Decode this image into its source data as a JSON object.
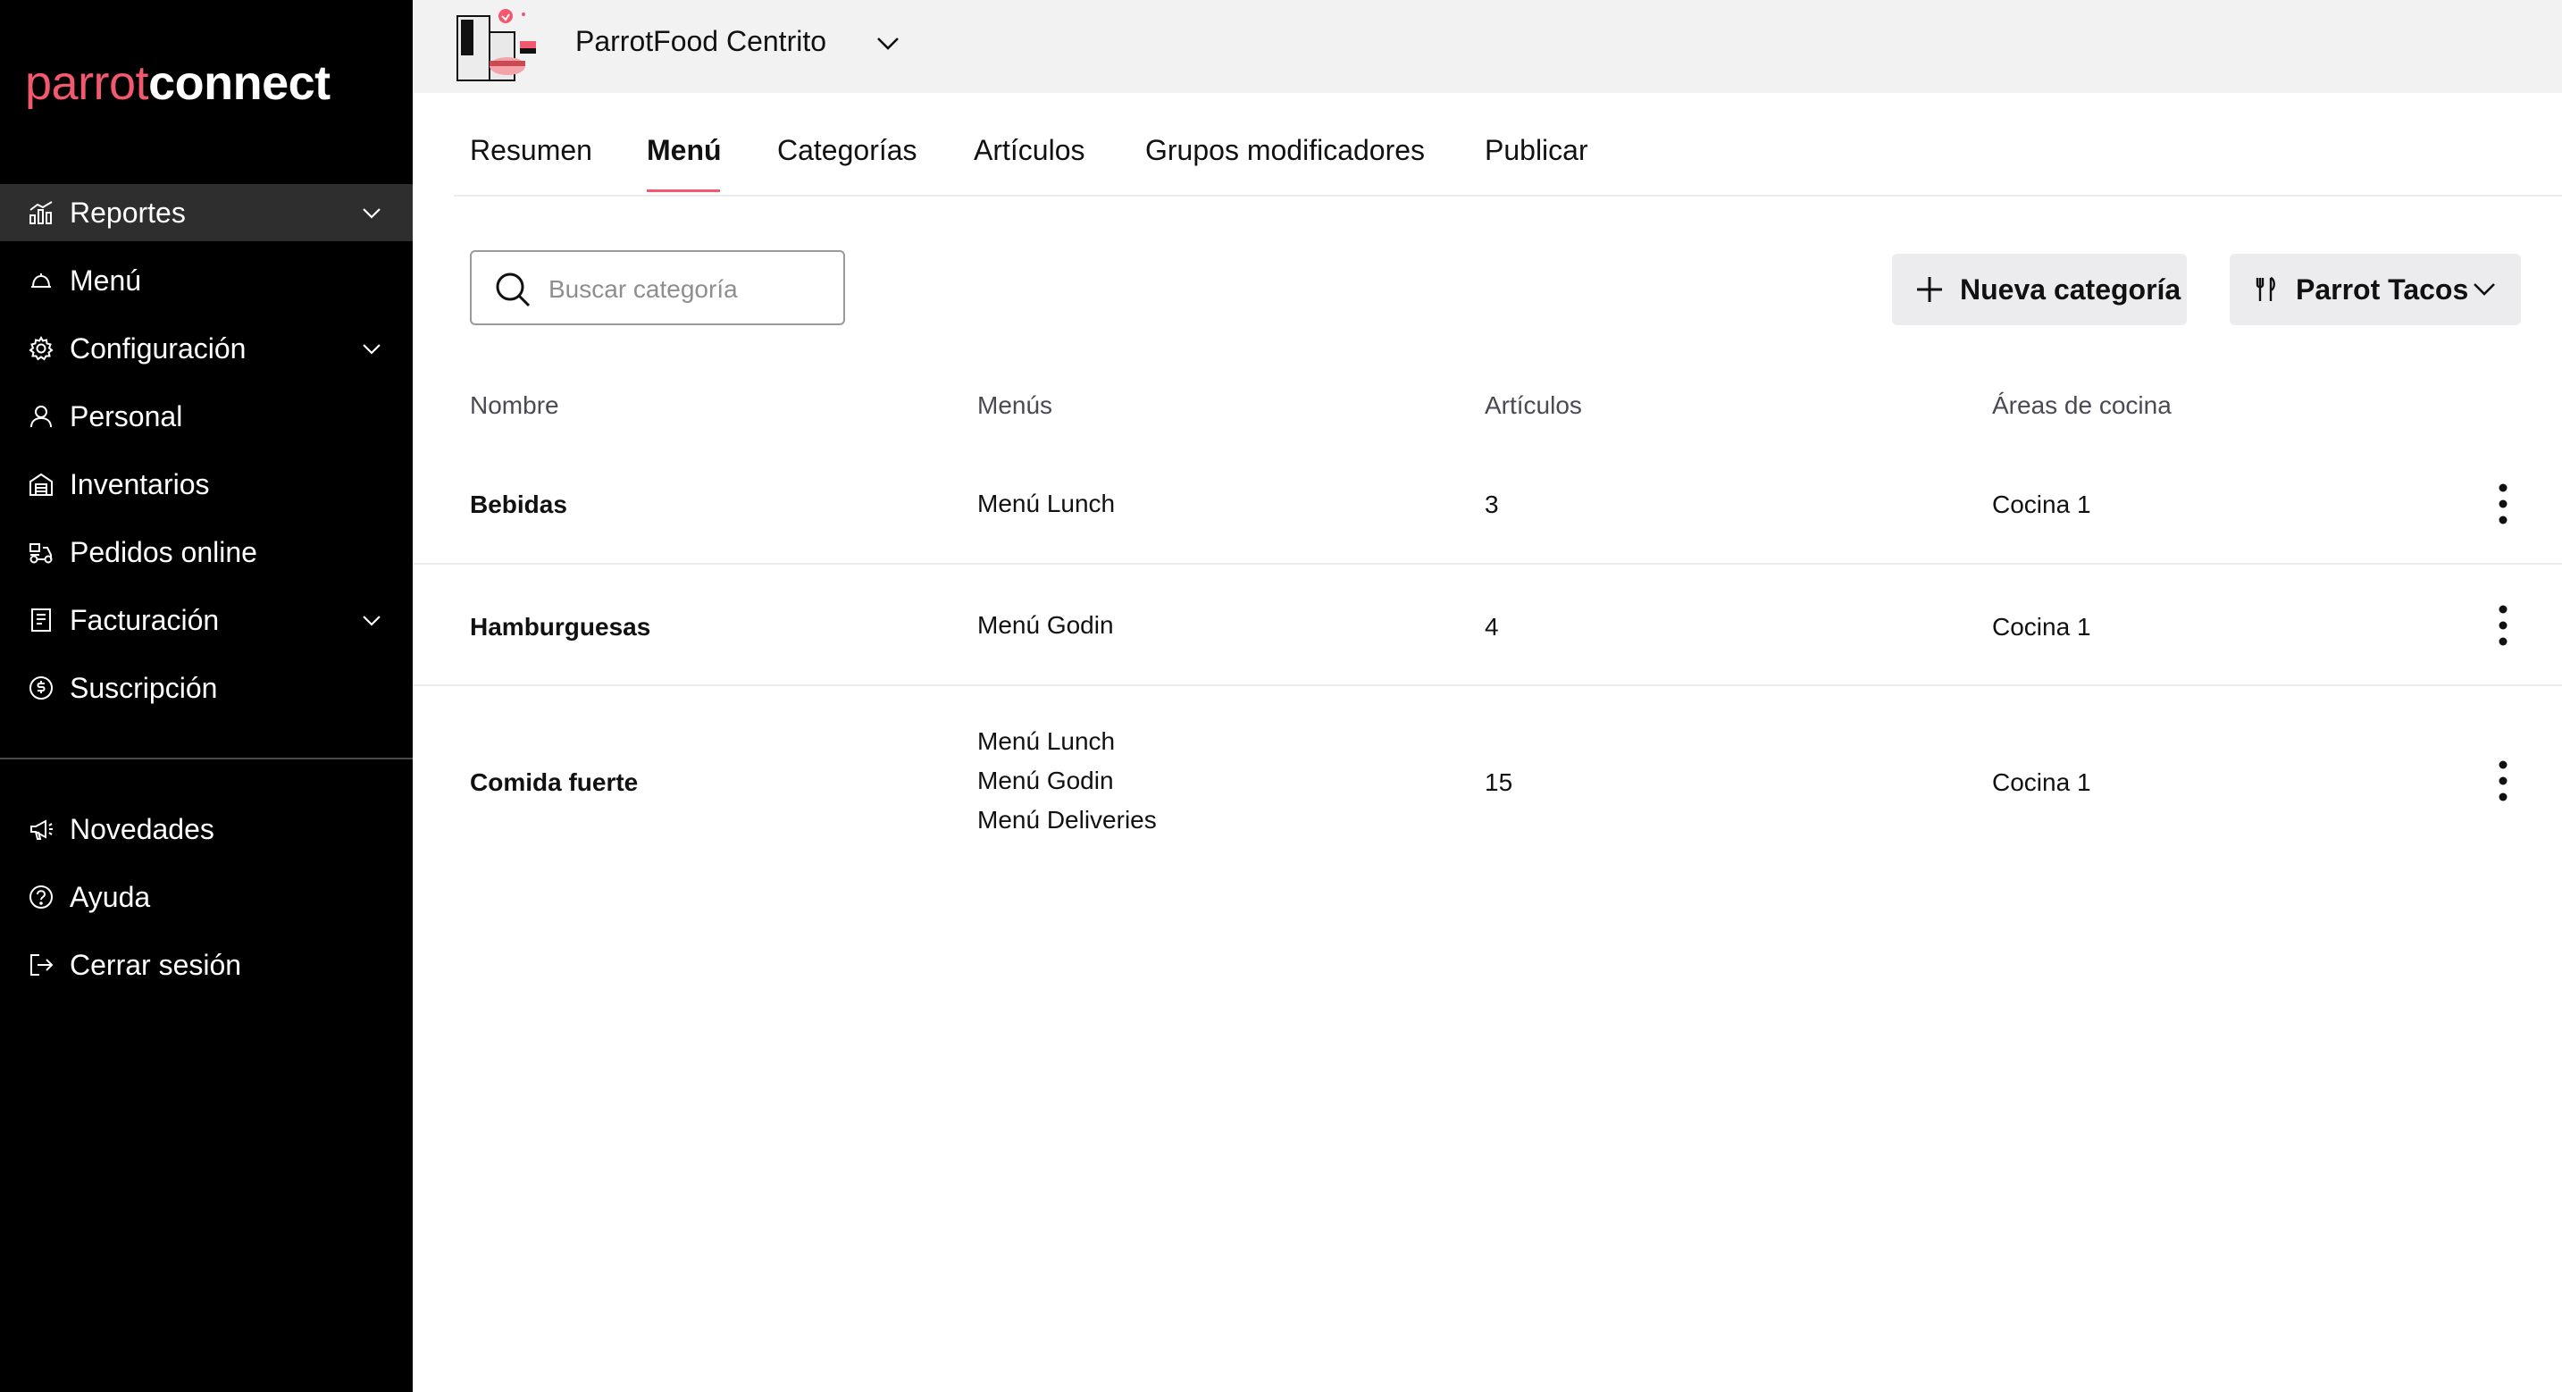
{
  "brand": {
    "logo_part1": "parrot",
    "logo_part2": "connect",
    "accent_color": "#f2586e"
  },
  "sidebar": {
    "items": [
      {
        "label": "Reportes",
        "icon": "chart-icon",
        "has_chevron": true,
        "active": true
      },
      {
        "label": "Menú",
        "icon": "cloche-icon",
        "has_chevron": false
      },
      {
        "label": "Configuración",
        "icon": "gear-icon",
        "has_chevron": true
      },
      {
        "label": "Personal",
        "icon": "user-icon",
        "has_chevron": false
      },
      {
        "label": "Inventarios",
        "icon": "warehouse-icon",
        "has_chevron": false
      },
      {
        "label": "Pedidos online",
        "icon": "delivery-icon",
        "has_chevron": false
      },
      {
        "label": "Facturación",
        "icon": "invoice-icon",
        "has_chevron": true
      },
      {
        "label": "Suscripción",
        "icon": "subscription-icon",
        "has_chevron": false
      }
    ],
    "bottom_items": [
      {
        "label": "Novedades",
        "icon": "megaphone-icon"
      },
      {
        "label": "Ayuda",
        "icon": "help-icon"
      },
      {
        "label": "Cerrar sesión",
        "icon": "logout-icon"
      }
    ]
  },
  "topbar": {
    "store_name": "ParrotFood Centrito"
  },
  "tabs": [
    {
      "label": "Resumen",
      "active": false
    },
    {
      "label": "Menú",
      "active": true
    },
    {
      "label": "Categorías",
      "active": false
    },
    {
      "label": "Artículos",
      "active": false
    },
    {
      "label": "Grupos modificadores",
      "active": false
    },
    {
      "label": "Publicar",
      "active": false
    }
  ],
  "toolbar": {
    "search_placeholder": "Buscar categoría",
    "new_category_label": "Nueva categoría",
    "menu_selector_label": "Parrot Tacos"
  },
  "table": {
    "headers": [
      "Nombre",
      "Menús",
      "Artículos",
      "Áreas de cocina"
    ],
    "rows": [
      {
        "name": "Bebidas",
        "menus": [
          "Menú Lunch"
        ],
        "articles": "3",
        "kitchen": "Cocina 1"
      },
      {
        "name": "Hamburguesas",
        "menus": [
          "Menú Godin"
        ],
        "articles": "4",
        "kitchen": "Cocina 1"
      },
      {
        "name": "Comida fuerte",
        "menus": [
          "Menú Lunch",
          "Menú Godin",
          "Menú Deliveries"
        ],
        "articles": "15",
        "kitchen": "Cocina 1"
      }
    ]
  }
}
